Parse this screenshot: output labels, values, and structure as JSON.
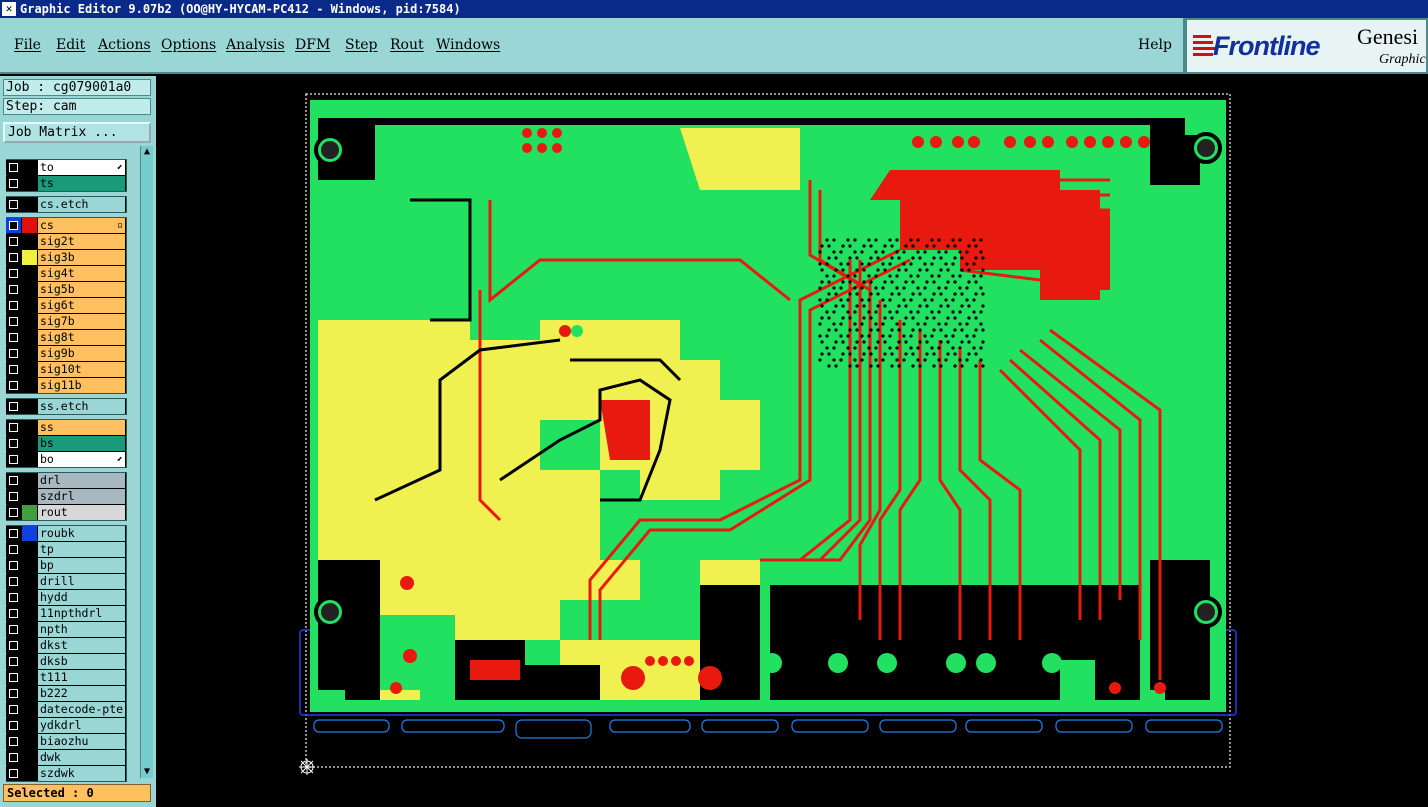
{
  "window": {
    "title": "Graphic Editor 9.07b2 (OO@HY-HYCAM-PC412 - Windows, pid:7584)"
  },
  "menu": [
    "File",
    "Edit",
    "Actions",
    "Options",
    "Analysis",
    "DFM",
    "Step",
    "Rout",
    "Windows"
  ],
  "help_label": "Help",
  "logo": {
    "brand": "Frontline",
    "product": "Genesi",
    "product_sub": "Graphic"
  },
  "job": {
    "label": "Job : cg079001a0",
    "step": "Step: cam",
    "matrix_button": "Job Matrix ..."
  },
  "layers": [
    {
      "name": "to",
      "bg": "#ffffff",
      "swatch": "#000000",
      "mark": "⬋"
    },
    {
      "name": "ts",
      "bg": "#1a9a7a",
      "swatch": "#000000"
    },
    {
      "name": "cs.etch",
      "bg": "#9ad6d6",
      "swatch": "#000000"
    },
    {
      "name": "cs",
      "bg": "#ffc060",
      "swatch": "#e01010",
      "mark": "▫",
      "selected": true
    },
    {
      "name": "sig2t",
      "bg": "#ffc060",
      "swatch": "#000000"
    },
    {
      "name": "sig3b",
      "bg": "#ffc060",
      "swatch": "#f0f040"
    },
    {
      "name": "sig4t",
      "bg": "#ffc060",
      "swatch": "#000000"
    },
    {
      "name": "sig5b",
      "bg": "#ffc060",
      "swatch": "#000000"
    },
    {
      "name": "sig6t",
      "bg": "#ffc060",
      "swatch": "#000000"
    },
    {
      "name": "sig7b",
      "bg": "#ffc060",
      "swatch": "#000000"
    },
    {
      "name": "sig8t",
      "bg": "#ffc060",
      "swatch": "#000000"
    },
    {
      "name": "sig9b",
      "bg": "#ffc060",
      "swatch": "#000000"
    },
    {
      "name": "sig10t",
      "bg": "#ffc060",
      "swatch": "#000000"
    },
    {
      "name": "sig11b",
      "bg": "#ffc060",
      "swatch": "#000000"
    },
    {
      "name": "ss.etch",
      "bg": "#9ad6d6",
      "swatch": "#000000"
    },
    {
      "name": "ss",
      "bg": "#ffc060",
      "swatch": "#000000"
    },
    {
      "name": "bs",
      "bg": "#1a9a7a",
      "swatch": "#000000"
    },
    {
      "name": "bo",
      "bg": "#ffffff",
      "swatch": "#000000",
      "mark": "⬋"
    },
    {
      "name": "drl",
      "bg": "#a8b8c0",
      "swatch": "#000000"
    },
    {
      "name": "szdrl",
      "bg": "#a8b8c0",
      "swatch": "#000000"
    },
    {
      "name": "rout",
      "bg": "#d8d8d8",
      "swatch": "#40a040"
    },
    {
      "name": "roubk",
      "bg": "#9ad6d6",
      "swatch": "#1040e0"
    },
    {
      "name": "tp",
      "bg": "#9ad6d6",
      "swatch": "#000000"
    },
    {
      "name": "bp",
      "bg": "#9ad6d6",
      "swatch": "#000000"
    },
    {
      "name": "drill",
      "bg": "#9ad6d6",
      "swatch": "#000000"
    },
    {
      "name": "hydd",
      "bg": "#9ad6d6",
      "swatch": "#000000"
    },
    {
      "name": "11npthdrl",
      "bg": "#9ad6d6",
      "swatch": "#000000"
    },
    {
      "name": "npth",
      "bg": "#9ad6d6",
      "swatch": "#000000"
    },
    {
      "name": "dkst",
      "bg": "#9ad6d6",
      "swatch": "#000000"
    },
    {
      "name": "dksb",
      "bg": "#9ad6d6",
      "swatch": "#000000"
    },
    {
      "name": "t111",
      "bg": "#9ad6d6",
      "swatch": "#000000"
    },
    {
      "name": "b222",
      "bg": "#9ad6d6",
      "swatch": "#000000"
    },
    {
      "name": "datecode-pte",
      "bg": "#9ad6d6",
      "swatch": "#000000"
    },
    {
      "name": "ydkdrl",
      "bg": "#9ad6d6",
      "swatch": "#000000"
    },
    {
      "name": "biaozhu",
      "bg": "#9ad6d6",
      "swatch": "#000000"
    },
    {
      "name": "dwk",
      "bg": "#9ad6d6",
      "swatch": "#000000"
    },
    {
      "name": "szdwk",
      "bg": "#9ad6d6",
      "swatch": "#000000"
    }
  ],
  "status": {
    "selected": "Selected : 0"
  },
  "colors": {
    "board": "#22e060",
    "copper": "#e81a10",
    "silk": "#f0f050",
    "drill_black": "#000000",
    "profile_blue": "#2040e0"
  }
}
